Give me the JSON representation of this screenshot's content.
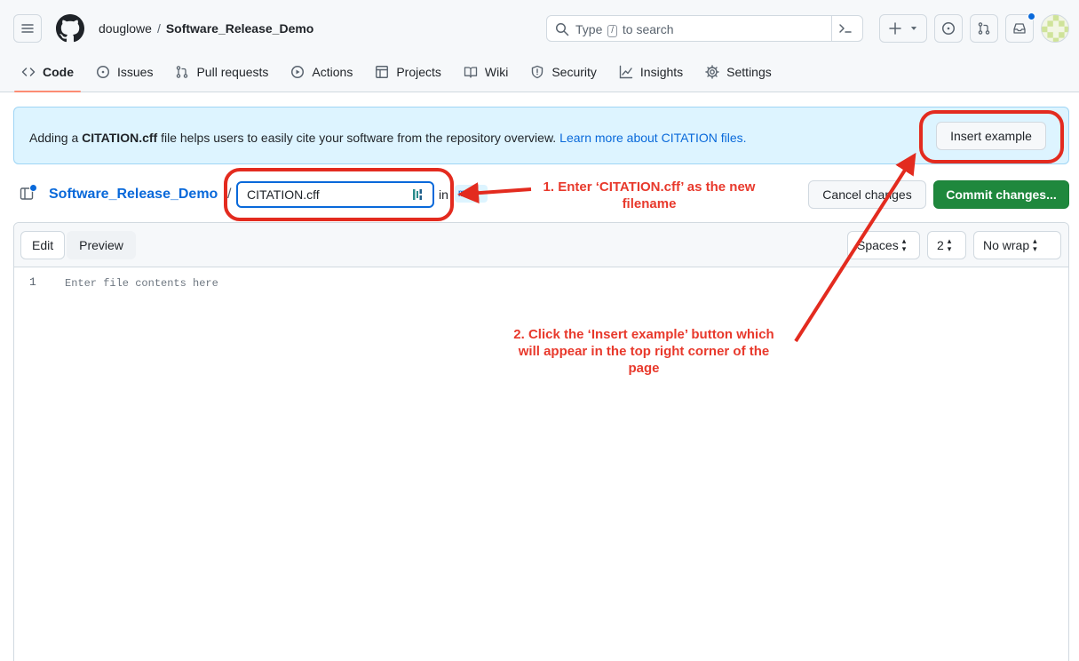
{
  "header": {
    "owner": "douglowe",
    "separator": "/",
    "repo": "Software_Release_Demo",
    "search": {
      "prefix": "Type",
      "key": "/",
      "suffix": "to search"
    }
  },
  "tabs": [
    {
      "label": "Code",
      "icon": "code-icon",
      "selected": true
    },
    {
      "label": "Issues",
      "icon": "issue-opened-icon"
    },
    {
      "label": "Pull requests",
      "icon": "git-pull-request-icon"
    },
    {
      "label": "Actions",
      "icon": "play-icon"
    },
    {
      "label": "Projects",
      "icon": "table-icon"
    },
    {
      "label": "Wiki",
      "icon": "book-icon"
    },
    {
      "label": "Security",
      "icon": "shield-icon"
    },
    {
      "label": "Insights",
      "icon": "graph-icon"
    },
    {
      "label": "Settings",
      "icon": "gear-icon"
    }
  ],
  "banner": {
    "pre": "Adding a ",
    "file": "CITATION.cff",
    "post": " file helps users to easily cite your software from the repository overview.",
    "link": "Learn more about CITATION files.",
    "button": "Insert example"
  },
  "file_row": {
    "repo": "Software_Release_Demo",
    "slash": "/",
    "filename": "CITATION.cff",
    "in": "in",
    "branch": "ma",
    "cancel": "Cancel changes",
    "commit": "Commit changes..."
  },
  "editor": {
    "tab_edit": "Edit",
    "tab_preview": "Preview",
    "indent_mode": "Spaces",
    "indent_size": "2",
    "wrap_mode": "No wrap",
    "line_number": "1",
    "placeholder": "Enter file contents here"
  },
  "annotations": {
    "step1_line1": "1. Enter ‘CITATION.cff’ as the new",
    "step1_line2": "filename",
    "step2_line1": "2. Click the ‘Insert example’ button which",
    "step2_line2": "will appear in the top right corner of the",
    "step2_line3": "page"
  },
  "colors": {
    "accent": "#0969da",
    "commit_green": "#1f883d",
    "annotation_red": "#e32b1f",
    "banner_bg": "#ddf4ff",
    "tab_underline": "#fd8c73"
  }
}
